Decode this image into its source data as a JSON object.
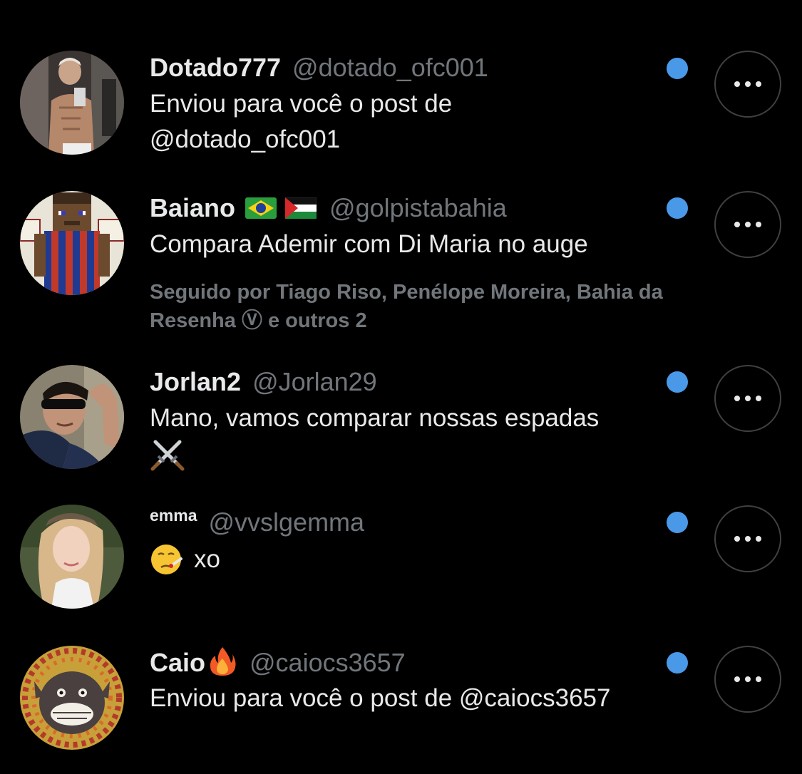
{
  "colors": {
    "background": "#000000",
    "primary_text": "#e7e9ea",
    "secondary_text": "#71767b",
    "unread_dot": "#4a99e9",
    "more_button_border": "#3e4144"
  },
  "requests": [
    {
      "name": "Dotado777",
      "handle": "@dotado_ofc001",
      "message_line1": "Enviou para você o post de",
      "message_line2": "@dotado_ofc001",
      "unread": true
    },
    {
      "name": "Baiano",
      "name_icons": [
        "brazil-flag-icon",
        "palestine-flag-icon"
      ],
      "handle": "@golpistabahia",
      "message": "Compara Ademir com Di Maria no auge",
      "followed_by": "Seguido por Tiago Riso, Penélope Moreira, Bahia da Resenha Ⓥ e outros 2",
      "unread": true
    },
    {
      "name": "Jorlan2",
      "handle": "@Jorlan29",
      "message": "Mano, vamos comparar nossas espadas",
      "message_icon": "crossed-swords-icon",
      "unread": true
    },
    {
      "name": "emma",
      "handle": "@vvslgemma",
      "message_icon": "thermometer-face-icon",
      "message": "xo",
      "unread": true
    },
    {
      "name": "Caio",
      "name_icon": "fire-icon",
      "handle": "@caiocs3657",
      "message": "Enviou para você o post de @caiocs3657",
      "unread": true
    }
  ],
  "more_button_icon": "more-horizontal-icon"
}
